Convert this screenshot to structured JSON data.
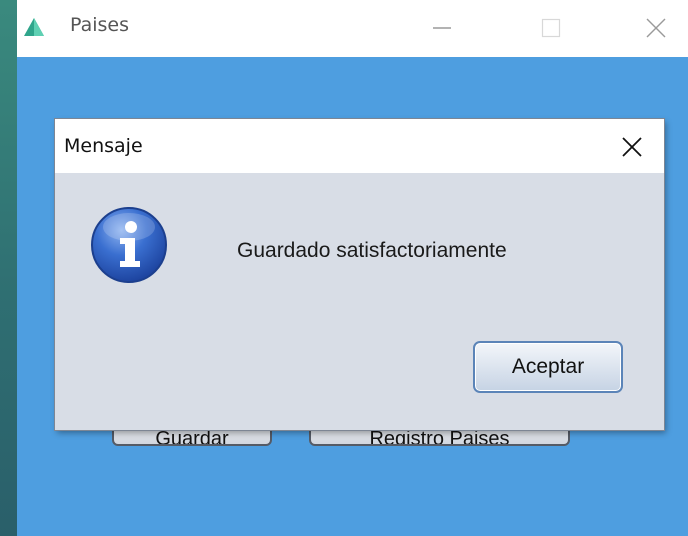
{
  "main_window": {
    "title": "Paises",
    "background_color": "#4e9ee0",
    "app_icon": "triangle-app-icon",
    "controls": {
      "minimize_icon": "minimize-icon",
      "maximize_icon": "maximize-icon",
      "close_icon": "close-icon"
    },
    "buttons": {
      "guardar_label": "Guardar",
      "registro_label": "Registro Paises"
    }
  },
  "dialog": {
    "title": "Mensaje",
    "message": "Guardado satisfactoriamente",
    "icon": "info-icon",
    "accept_label": "Aceptar",
    "close_icon": "close-icon"
  }
}
